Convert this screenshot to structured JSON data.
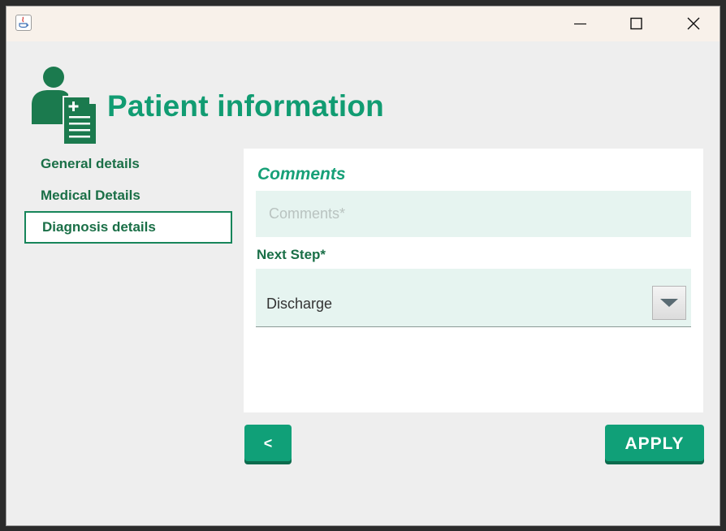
{
  "window": {
    "icons": {
      "app": "java-app-icon",
      "minimize": "minimize-icon",
      "maximize": "maximize-icon",
      "close": "close-icon"
    }
  },
  "header": {
    "title": "Patient information",
    "icon": "patient-document-icon"
  },
  "sidebar": {
    "items": [
      {
        "label": "General details",
        "active": false
      },
      {
        "label": "Medical Details",
        "active": false
      },
      {
        "label": "Diagnosis details",
        "active": true
      }
    ]
  },
  "form": {
    "section_title": "Comments",
    "comments": {
      "value": "",
      "placeholder": "Comments*"
    },
    "next_step": {
      "label": "Next Step*",
      "selected": "Discharge"
    }
  },
  "buttons": {
    "back_label": "<",
    "apply_label": "APPLY"
  },
  "colors": {
    "accent": "#10a078",
    "title": "#119c72",
    "text_dark_green": "#1a6f47",
    "field_bg": "#e6f4f0"
  }
}
